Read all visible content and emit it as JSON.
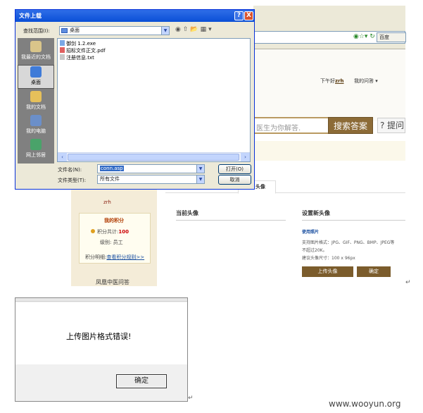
{
  "browser": {
    "home_label": "百度",
    "address_icons": "◉☆▾ ↻"
  },
  "website": {
    "greeting": "下午好",
    "username": "zrh",
    "my_questions": "我的问答 ▾",
    "search_placeholder": "医生为你解答.",
    "search_button": "搜索答案",
    "ask_button": "? 提问",
    "tab_avatar": "头像",
    "user_name_small": "zrh",
    "score_title": "我的积分",
    "score_total_label": "积分共计:",
    "score_total_value": "100",
    "level": "级别: 员工",
    "score_detail_label": "积分明细:",
    "score_rules_link": "查看积分规则>>",
    "forum_name": "凤凰中医问答",
    "current_avatar_title": "当前头像",
    "new_avatar_title": "设置新头像",
    "use_photo": "使用照片",
    "support_formats": "支持图片格式：JPG、GIF、PNG、BMP、JPEG等",
    "size_limit": "不超过20K。",
    "suggest_size": "建议头像尺寸：100 x 96px",
    "upload_button": "上传头像",
    "confirm_button": "确定",
    "paragraph_mark": "↵"
  },
  "file_dialog": {
    "title": "文件上载",
    "help": "?",
    "close": "X",
    "look_in_label": "查找范围(I):",
    "look_in_value": "桌面",
    "nav_icons": "◉⇧📂▦▾",
    "sidebar": [
      {
        "label": "我最近的文档",
        "color": "#d9c58a"
      },
      {
        "label": "桌面",
        "color": "#3f7bd8"
      },
      {
        "label": "我的文档",
        "color": "#e6c05a"
      },
      {
        "label": "我的电脑",
        "color": "#6b8fc9"
      },
      {
        "label": "网上邻居",
        "color": "#4aa36a"
      }
    ],
    "files": [
      {
        "name": "御剑 1.2.exe",
        "color": "#7aa7e6"
      },
      {
        "name": "招标文件正文.pdf",
        "color": "#e06060"
      },
      {
        "name": "注册信息.txt",
        "color": "#c8c8c8"
      }
    ],
    "scroll_left": "‹",
    "scroll_right": "›",
    "filename_label": "文件名(N):",
    "filename_value": "conn.asp",
    "filetype_label": "文件类型(T):",
    "filetype_value": "所有文件",
    "open_button": "打开(O)",
    "cancel_button": "取消",
    "dropdown_arrow": "▼"
  },
  "message_box": {
    "text": "上传图片格式错误!",
    "ok_button": "确定"
  },
  "watermark": "www.wooyun.org"
}
